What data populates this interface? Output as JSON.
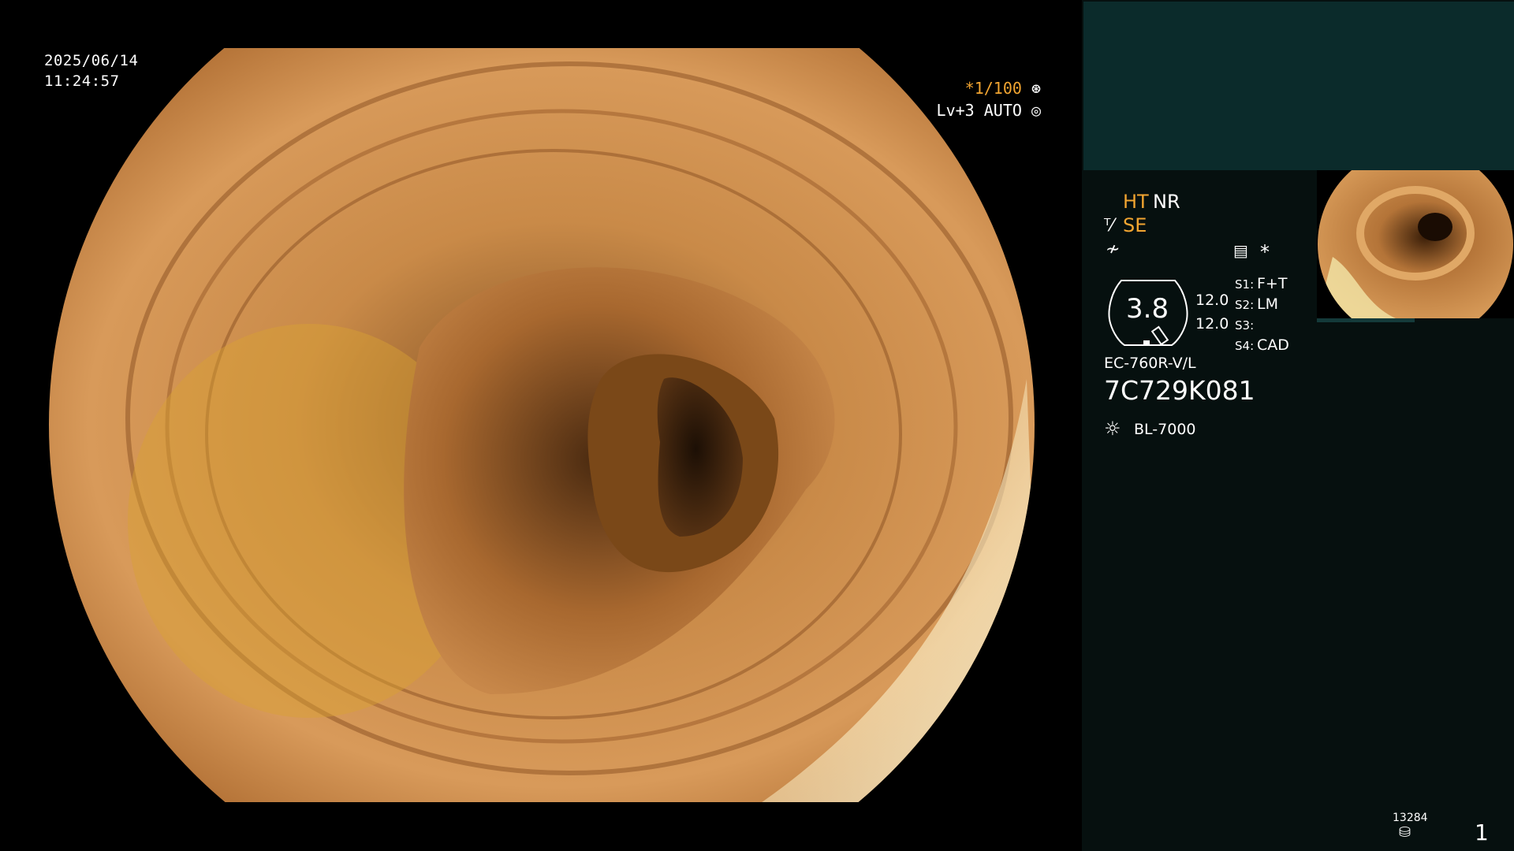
{
  "overlay": {
    "date": "2025/06/14",
    "time": "11:24:57",
    "shutter": "*1/100",
    "shutter_icon": "aperture-icon",
    "level": "Lv+3 AUTO",
    "level_icon": "auto-iris-icon"
  },
  "panel": {
    "ht": "HT",
    "nr": "NR",
    "se": "SE",
    "se_icon": "structure-enhancement-icon",
    "freeze_icon": "freeze-icon",
    "settings_icon": "settings-list-icon",
    "asterisk": "*",
    "zoom_value": "3.8",
    "values": [
      "12.0",
      "12.0"
    ],
    "switches": [
      {
        "key": "S1:",
        "value": "F+T"
      },
      {
        "key": "S2:",
        "value": "LM"
      },
      {
        "key": "S3:",
        "value": ""
      },
      {
        "key": "S4:",
        "value": "CAD"
      }
    ],
    "scope_model": "EC-760R-V/L",
    "scope_serial": "7C729K081",
    "light_icon": "light-source-icon",
    "light_source": "BL-7000",
    "counter": "13284",
    "counter_icon": "storage-icon",
    "page_number": "1"
  },
  "colors": {
    "panel_bg": "#06100f",
    "panel_top": "#0b2b2b",
    "accent_amber": "#f2a531"
  }
}
